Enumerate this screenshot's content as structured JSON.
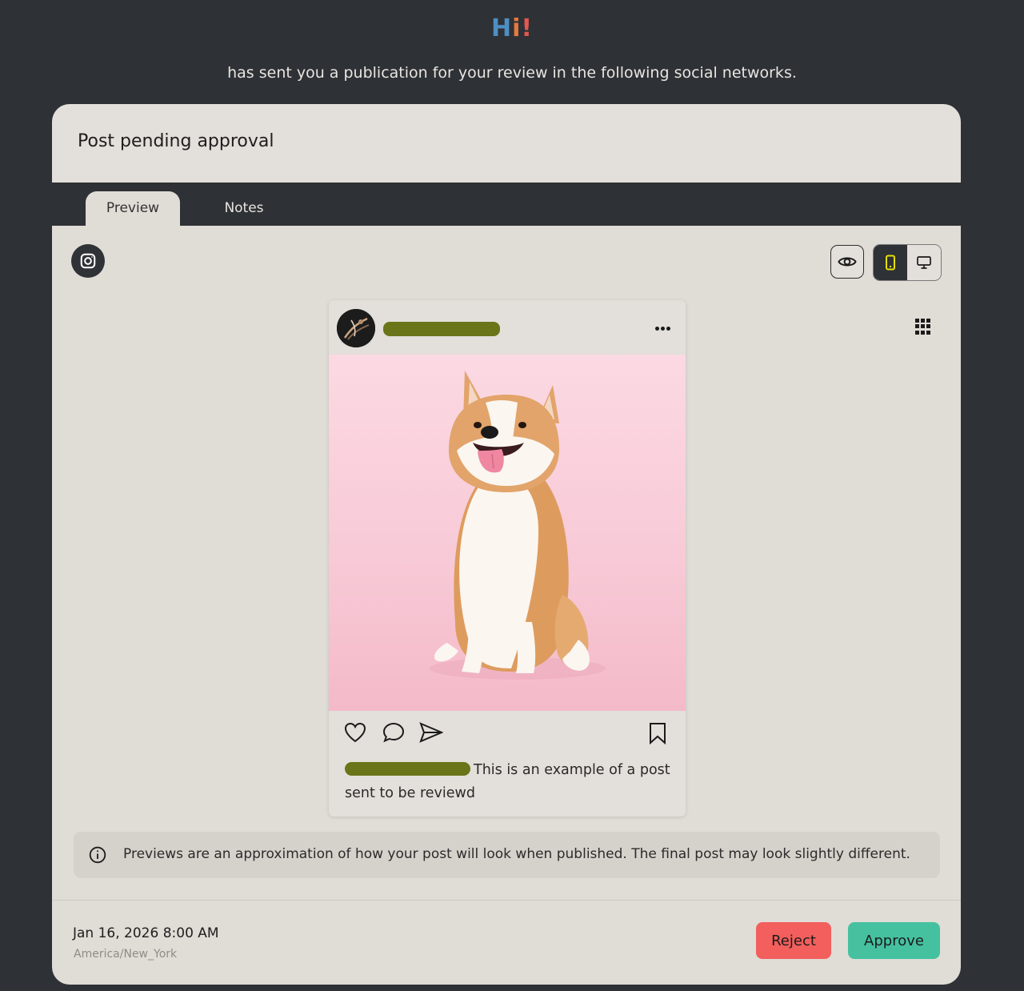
{
  "greeting": {
    "h": "H",
    "i": "i",
    "exclaim": "!"
  },
  "subtitle": "has sent you a publication for your review in the following social networks.",
  "card": {
    "title": "Post pending approval"
  },
  "tabs": [
    {
      "label": "Preview",
      "active": true
    },
    {
      "label": "Notes",
      "active": false
    }
  ],
  "network": {
    "icon": "instagram-icon"
  },
  "view_controls": {
    "preview_icon": "eye-icon",
    "devices": [
      {
        "icon": "mobile-icon",
        "active": true,
        "color": "#e6e000"
      },
      {
        "icon": "desktop-icon",
        "active": false
      }
    ],
    "grid_icon": "grid-icon"
  },
  "post": {
    "username_redacted": true,
    "image": "shiba-inu-dog-on-pink-background",
    "actions": [
      "heart-icon",
      "comment-icon",
      "send-icon"
    ],
    "save_icon": "bookmark-icon",
    "caption": "This is an example of a post sent to be reviewd"
  },
  "info": {
    "icon": "info-icon",
    "text": "Previews are an approximation of how your post will look when published. The final post may look slightly different."
  },
  "footer": {
    "date": "Jan 16, 2026 8:00 AM",
    "timezone": "America/New_York",
    "reject_label": "Reject",
    "approve_label": "Approve"
  },
  "colors": {
    "background": "#2e3135",
    "card": "#e0dcd6",
    "reject": "#f25f5c",
    "approve": "#45c1a0",
    "greeting_h": "#4d8fc4",
    "greeting_i": "#e57a3e",
    "greeting_exclaim": "#e6574f"
  }
}
